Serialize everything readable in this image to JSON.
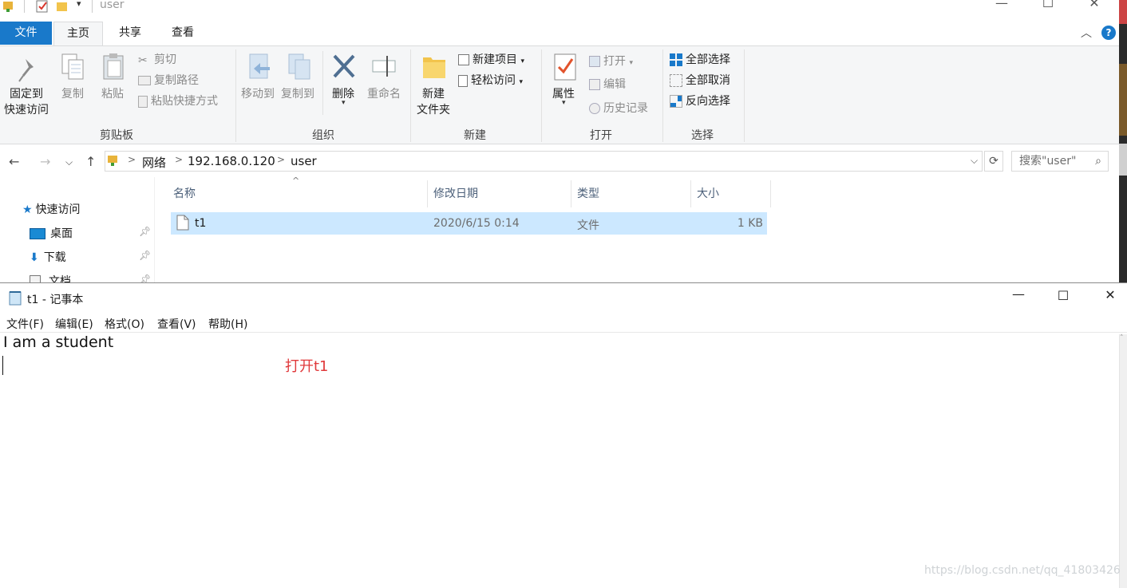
{
  "explorer": {
    "title": "user",
    "window_controls": [
      "—",
      "☐",
      "✕"
    ],
    "tabs": {
      "file": "文件",
      "home": "主页",
      "share": "共享",
      "view": "查看"
    },
    "ribbon": {
      "clipboard": {
        "pin_label_1": "固定到",
        "pin_label_2": "快速访问",
        "copy": "复制",
        "paste": "粘贴",
        "cut": "剪切",
        "copy_path": "复制路径",
        "paste_shortcut": "粘贴快捷方式",
        "group": "剪贴板"
      },
      "organize": {
        "move_to": "移动到",
        "copy_to": "复制到",
        "delete": "删除",
        "rename": "重命名",
        "group": "组织"
      },
      "new": {
        "new_folder_1": "新建",
        "new_folder_2": "文件夹",
        "new_item": "新建项目",
        "easy_access": "轻松访问",
        "group": "新建"
      },
      "open": {
        "properties": "属性",
        "open": "打开",
        "edit": "编辑",
        "history": "历史记录",
        "group": "打开"
      },
      "select": {
        "select_all": "全部选择",
        "select_none": "全部取消",
        "invert": "反向选择",
        "group": "选择"
      }
    },
    "address": {
      "crumbs": [
        "网络",
        "192.168.0.120",
        "user"
      ],
      "search_placeholder": "搜索\"user\""
    },
    "nav": {
      "quick_access": "快速访问",
      "items": [
        "桌面",
        "下载",
        "文档"
      ]
    },
    "columns": [
      "名称",
      "修改日期",
      "类型",
      "大小"
    ],
    "files": [
      {
        "name": "t1",
        "modified": "2020/6/15 0:14",
        "type": "文件",
        "size": "1 KB"
      }
    ]
  },
  "notepad": {
    "title": "t1 - 记事本",
    "menu": [
      "文件(F)",
      "编辑(E)",
      "格式(O)",
      "查看(V)",
      "帮助(H)"
    ],
    "content": "I am a student",
    "annotation": "打开t1",
    "watermark": "https://blog.csdn.net/qq_41803426"
  },
  "colors": {
    "accent": "#1979ca",
    "selection": "#cce8ff",
    "annotation": "#e0393b"
  }
}
